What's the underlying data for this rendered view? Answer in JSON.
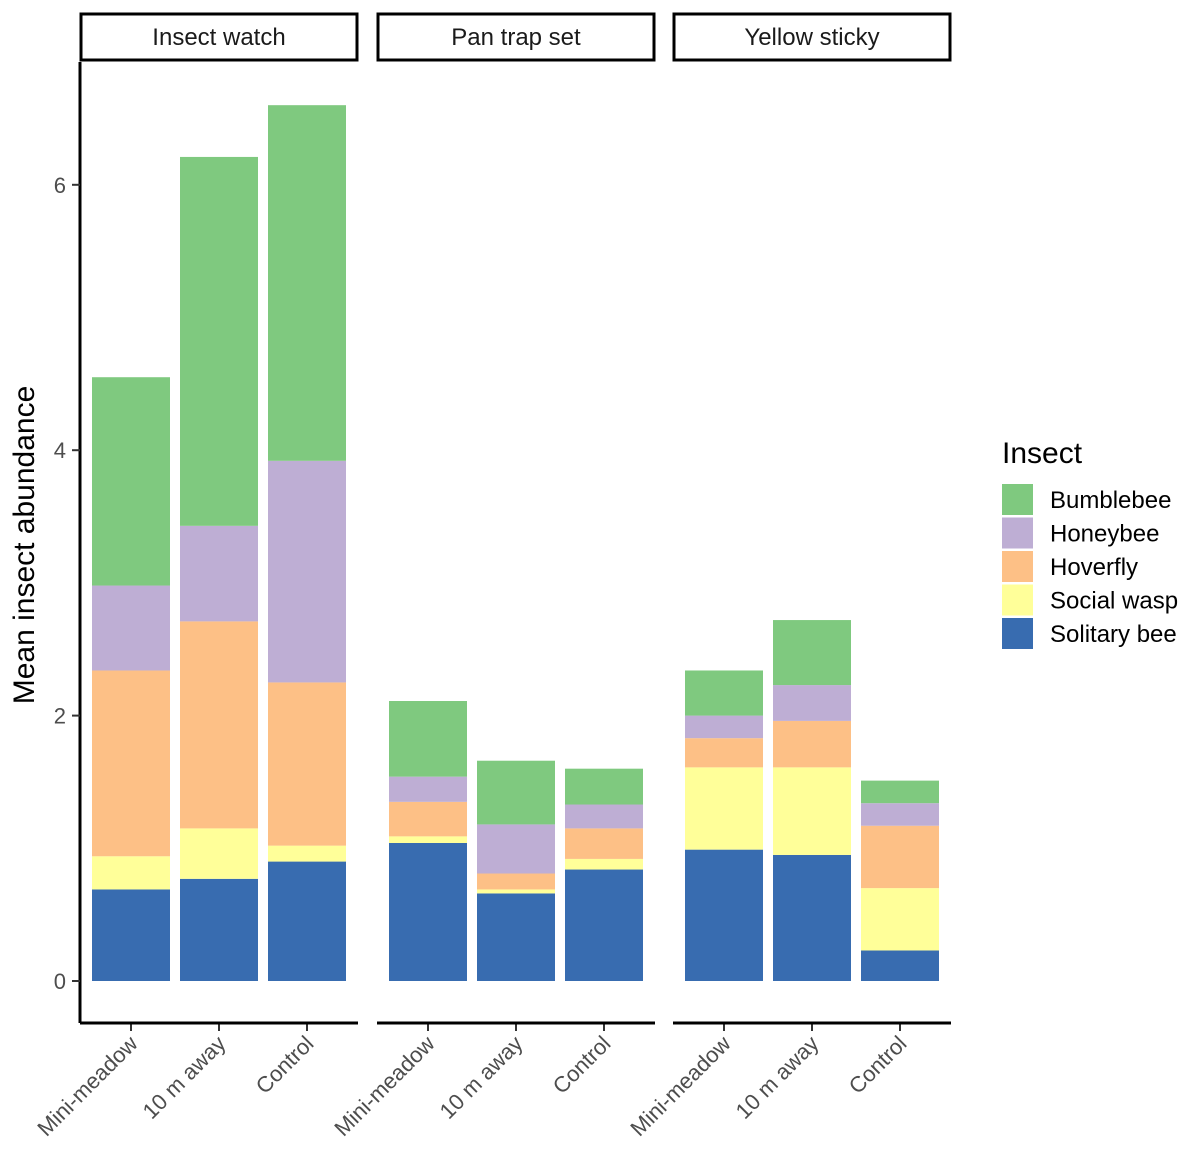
{
  "chart_data": {
    "type": "bar",
    "stacked": true,
    "title": "",
    "xlabel": "",
    "ylabel": "Mean insect abundance",
    "ylim": [
      -0.3,
      6.8
    ],
    "yticks": [
      0,
      2,
      4,
      6
    ],
    "grid": false,
    "categories": [
      "Mini-meadow",
      "10 m away",
      "Control"
    ],
    "legend": {
      "title": "Insect",
      "position": "right"
    },
    "series_order_top_to_bottom": [
      "Bumblebee",
      "Honeybee",
      "Hoverfly",
      "Social wasp",
      "Solitary bee"
    ],
    "colors": {
      "Bumblebee": "#7fc97f",
      "Honeybee": "#beaed4",
      "Hoverfly": "#fdc086",
      "Social wasp": "#ffff99",
      "Solitary bee": "#386cb0"
    },
    "facets": [
      {
        "name": "Insect watch",
        "series": [
          {
            "name": "Solitary bee",
            "values": [
              0.69,
              0.77,
              0.9
            ]
          },
          {
            "name": "Social wasp",
            "values": [
              0.25,
              0.38,
              0.12
            ]
          },
          {
            "name": "Hoverfly",
            "values": [
              1.4,
              1.56,
              1.23
            ]
          },
          {
            "name": "Honeybee",
            "values": [
              0.64,
              0.72,
              1.67
            ]
          },
          {
            "name": "Bumblebee",
            "values": [
              1.57,
              2.78,
              2.68
            ]
          }
        ]
      },
      {
        "name": "Pan trap set",
        "series": [
          {
            "name": "Solitary bee",
            "values": [
              1.04,
              0.66,
              0.84
            ]
          },
          {
            "name": "Social wasp",
            "values": [
              0.05,
              0.03,
              0.08
            ]
          },
          {
            "name": "Hoverfly",
            "values": [
              0.26,
              0.12,
              0.23
            ]
          },
          {
            "name": "Honeybee",
            "values": [
              0.19,
              0.37,
              0.18
            ]
          },
          {
            "name": "Bumblebee",
            "values": [
              0.57,
              0.48,
              0.27
            ]
          }
        ]
      },
      {
        "name": "Yellow sticky",
        "series": [
          {
            "name": "Solitary bee",
            "values": [
              0.99,
              0.95,
              0.23
            ]
          },
          {
            "name": "Social wasp",
            "values": [
              0.62,
              0.66,
              0.47
            ]
          },
          {
            "name": "Hoverfly",
            "values": [
              0.22,
              0.35,
              0.47
            ]
          },
          {
            "name": "Honeybee",
            "values": [
              0.17,
              0.27,
              0.17
            ]
          },
          {
            "name": "Bumblebee",
            "values": [
              0.34,
              0.49,
              0.17
            ]
          }
        ]
      }
    ]
  }
}
